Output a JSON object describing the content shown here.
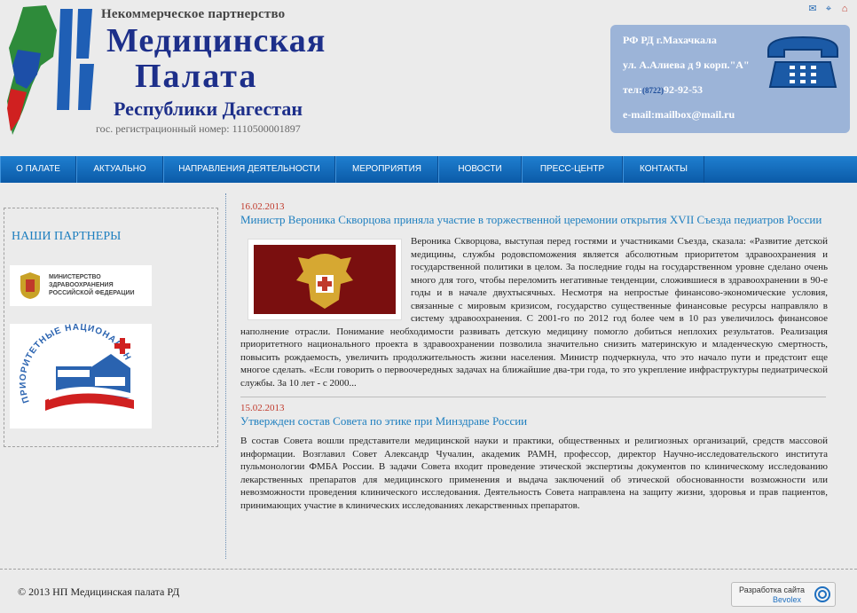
{
  "header": {
    "logo": {
      "top_line": "Некоммерческое партнерство",
      "line1": "Медицинская",
      "line2": "Палата",
      "line3": "Республики Дагестан",
      "registration": "гос. регистрационный номер: 1110500001897"
    },
    "icons": [
      "mail-icon",
      "sitemap-icon",
      "home-icon"
    ],
    "contact": {
      "city": "РФ РД г.Махачкала",
      "address": "ул. А.Алиева д 9 корп.\"А\"",
      "phone_label": "тел:",
      "phone_code": "(8722)",
      "phone_number": "92-92-53",
      "email": "e-mail:mailbox@mail.ru"
    }
  },
  "nav": {
    "items": [
      {
        "label": "О ПАЛАТЕ"
      },
      {
        "label": "АКТУАЛЬНО"
      },
      {
        "label": "НАПРАВЛЕНИЯ ДЕЯТЕЛЬНОСТИ"
      },
      {
        "label": "МЕРОПРИЯТИЯ"
      },
      {
        "label": "НОВОСТИ"
      },
      {
        "label": "ПРЕСС-ЦЕНТР"
      },
      {
        "label": "КОНТАКТЫ"
      }
    ]
  },
  "sidebar": {
    "title": "НАШИ ПАРТНЕРЫ",
    "partner1": {
      "line1": "МИНИСТЕРСТВО",
      "line2": "ЗДРАВООХРАНЕНИЯ",
      "line3": "РОССИЙСКОЙ ФЕДЕРАЦИИ"
    },
    "partner2": {
      "arc_text": "ПРИОРИТЕТНЫЕ НАЦИОНАЛЬНЫЕ ПРОЕКТЫ"
    }
  },
  "news": [
    {
      "date": "16.02.2013",
      "title": "Министр Вероника Скворцова приняла участие в торжественной церемонии открытия XVII Съезда педиатров России",
      "body": "Вероника Скворцова, выступая перед гостями и участниками Съезда, сказала: «Развитие детской медицины, службы родовспоможения является абсолютным приоритетом здравоохранения и государственной политики в целом. За последние годы на государственном уровне сделано очень много для того, чтобы переломить негативные тенденции, сложившиеся в здравоохранении в 90-е годы и в начале двухтысячных. Несмотря на непростые финансово-экономические условия, связанные с мировым кризисом, государство существенные финансовые ресурсы направляло в систему здравоохранения. С 2001-го по 2012 год более чем в 10 раз увеличилось финансовое наполнение отрасли. Понимание необходимости развивать детскую медицину помогло  добиться неплохих результатов. Реализация приоритетного национального проекта в здравоохранении позволила значительно снизить материнскую и младенческую смертность, повысить рождаемость, увеличить продолжительность жизни населения. Министр подчеркнула, что это начало пути и предстоит еще многое сделать. «Если говорить о первоочередных задачах на ближайшие два-три года, то это укрепление инфраструктуры педиатрической службы. За 10 лет -  с 2000..."
    },
    {
      "date": "15.02.2013",
      "title": "Утвержден состав Совета по этике при Минздраве России",
      "body": "В состав Совета вошли представители медицинской науки и практики, общественных и религиозных организаций, средств массовой информации. Возглавил Совет Александр Чучалин, академик РАМН, профессор, директор Научно-исследовательского института пульмонологии ФМБА России. В задачи Совета входит проведение этической экспертизы документов по клиническому исследованию лекарственных препаратов для медицинского применения и выдача заключений об этической обоснованности возможности или невозможности проведения клинического исследования. Деятельность Совета направлена  на защиту жизни, здоровья и прав пациентов, принимающих участие в клинических исследованиях лекарственных препаратов."
    }
  ],
  "footer": {
    "copyright": "© 2013 НП Медицинская палата РД",
    "dev_label": "Разработка сайта",
    "dev_name": "Bevolex"
  },
  "colors": {
    "nav_blue": "#0b5aa7",
    "link_blue": "#1e7fbf",
    "date_red": "#c0392b",
    "contact_box": "#9cb4d8"
  }
}
